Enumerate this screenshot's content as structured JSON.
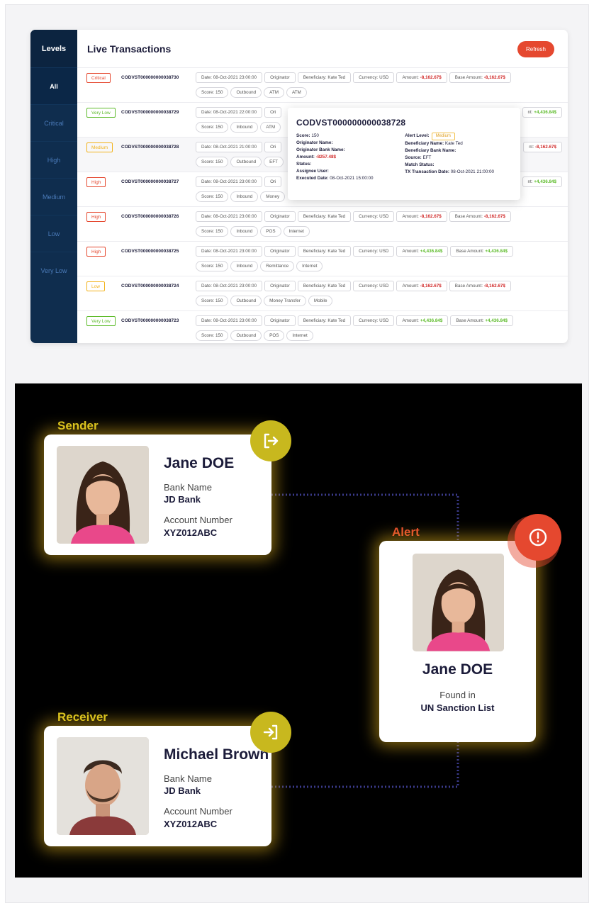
{
  "transactions": {
    "levels_header": "Levels",
    "levels": [
      "All",
      "Critical",
      "High",
      "Medium",
      "Low",
      "Very Low"
    ],
    "title": "Live Transactions",
    "refresh_label": "Refresh",
    "rows": [
      {
        "level": "Critical",
        "level_color": "#e5482f",
        "id": "CODVST000000000038730",
        "date": "Date: 08-Oct-2021 23:00:00",
        "originator": "Originator",
        "beneficiary": "Beneficiary: Kate Ted",
        "currency": "Currency: USD",
        "amount_label": "Amount:",
        "amount": "-8,162.67$",
        "base_label": "Base Amount:",
        "base": "-8,162.67$",
        "sign": "neg",
        "score": "Score: 150",
        "direction": "Outbound",
        "channel": "ATM",
        "extra": "ATM"
      },
      {
        "level": "Very Low",
        "level_color": "#5dbb2a",
        "id": "CODVST000000000038729",
        "date": "Date: 08-Oct-2021 22:00:00",
        "originator": "Ori",
        "beneficiary": "",
        "currency": "",
        "amount_label": "",
        "amount": "",
        "base_label": "nt:",
        "base": "+4,436.84$",
        "sign": "pos",
        "score": "Score: 150",
        "direction": "Inbound",
        "channel": "ATM",
        "extra": ""
      },
      {
        "level": "Medium",
        "level_color": "#f2b21a",
        "id": "CODVST000000000038728",
        "date": "Date: 08-Oct-2021 21:00:00",
        "originator": "Ori",
        "beneficiary": "",
        "currency": "",
        "amount_label": "",
        "amount": "",
        "base_label": "nt:",
        "base": "-8,162.67$",
        "sign": "neg",
        "score": "Score: 150",
        "direction": "Outbound",
        "channel": "EFT",
        "extra": ""
      },
      {
        "level": "High",
        "level_color": "#e5482f",
        "id": "CODVST000000000038727",
        "date": "Date: 08-Oct-2021 23:00:00",
        "originator": "Ori",
        "beneficiary": "",
        "currency": "",
        "amount_label": "",
        "amount": "",
        "base_label": "nt:",
        "base": "+4,436.84$",
        "sign": "pos",
        "score": "Score: 150",
        "direction": "Inbound",
        "channel": "Money",
        "extra": ""
      },
      {
        "level": "High",
        "level_color": "#e5482f",
        "id": "CODVST000000000038726",
        "date": "Date: 08-Oct-2021 23:00:00",
        "originator": "Originator",
        "beneficiary": "Beneficiary: Kate Ted",
        "currency": "Currency: USD",
        "amount_label": "Amount:",
        "amount": "-8,162.67$",
        "base_label": "Base Amount:",
        "base": "-8,162.67$",
        "sign": "neg",
        "score": "Score: 150",
        "direction": "Inbound",
        "channel": "POS",
        "extra": "Internet"
      },
      {
        "level": "High",
        "level_color": "#e5482f",
        "id": "CODVST000000000038725",
        "date": "Date: 08-Oct-2021 23:00:00",
        "originator": "Originator",
        "beneficiary": "Beneficiary: Kate Ted",
        "currency": "Currency: USD",
        "amount_label": "Amount:",
        "amount": "+4,436.84$",
        "base_label": "Base Amount:",
        "base": "+4,436.84$",
        "sign": "pos",
        "score": "Score: 150",
        "direction": "Inbound",
        "channel": "Remittance",
        "extra": "Internet"
      },
      {
        "level": "Low",
        "level_color": "#f2b21a",
        "id": "CODVST000000000038724",
        "date": "Date: 08-Oct-2021 23:00:00",
        "originator": "Originator",
        "beneficiary": "Beneficiary: Kate Ted",
        "currency": "Currency: USD",
        "amount_label": "Amount:",
        "amount": "-8,162.67$",
        "base_label": "Base Amount:",
        "base": "-8,162.67$",
        "sign": "neg",
        "score": "Score: 150",
        "direction": "Outbound",
        "channel": "Money Transfer",
        "extra": "Mobile"
      },
      {
        "level": "Very Low",
        "level_color": "#5dbb2a",
        "id": "CODVST000000000038723",
        "date": "Date: 08-Oct-2021 23:00:00",
        "originator": "Originator",
        "beneficiary": "Beneficiary: Kate Ted",
        "currency": "Currency: USD",
        "amount_label": "Amount:",
        "amount": "+4,436.84$",
        "base_label": "Base Amount:",
        "base": "+4,436.84$",
        "sign": "pos",
        "score": "Score: 150",
        "direction": "Outbound",
        "channel": "POS",
        "extra": "Internet"
      }
    ],
    "popup": {
      "title": "CODVST000000000038728",
      "score_label": "Score:",
      "score": "150",
      "originator_name_label": "Originator Name:",
      "originator_bank_label": "Originator Bank Name:",
      "amount_label": "Amount:",
      "amount": "-8257.48$",
      "status_label": "Status:",
      "assignee_label": "Assignee User:",
      "executed_label": "Executed Date:",
      "executed": "08-Oct-2021 15:00:00",
      "alert_level_label": "Alert Level:",
      "alert_level": "Medium",
      "beneficiary_name_label": "Beneficiary Name:",
      "beneficiary_name": "Kate Ted",
      "beneficiary_bank_label": "Beneficiary Bank Name:",
      "source_label": "Source:",
      "source": "EFT",
      "match_label": "Match Status:",
      "tx_date_label": "TX Transaction Date:",
      "tx_date": "08-Oct-2021 21:00:00"
    }
  },
  "illustration": {
    "sender": {
      "section_label": "Sender",
      "name": "Jane DOE",
      "bank_label": "Bank Name",
      "bank": "JD Bank",
      "account_label": "Account Number",
      "account": "XYZ012ABC",
      "icon": "sign-out-icon"
    },
    "receiver": {
      "section_label": "Receiver",
      "name": "Michael Brown",
      "bank_label": "Bank Name",
      "bank": "JD Bank",
      "account_label": "Account Number",
      "account": "XYZ012ABC",
      "icon": "sign-in-icon"
    },
    "alert": {
      "section_label": "Alert",
      "name": "Jane DOE",
      "found_label": "Found in",
      "list": "UN Sanction List",
      "icon": "exclamation-icon"
    },
    "colors": {
      "label_yellow": "#d9c51f",
      "alert_orange": "#e5482f",
      "icon_olive": "#c8b81e",
      "connector": "#3a3a8a"
    }
  }
}
